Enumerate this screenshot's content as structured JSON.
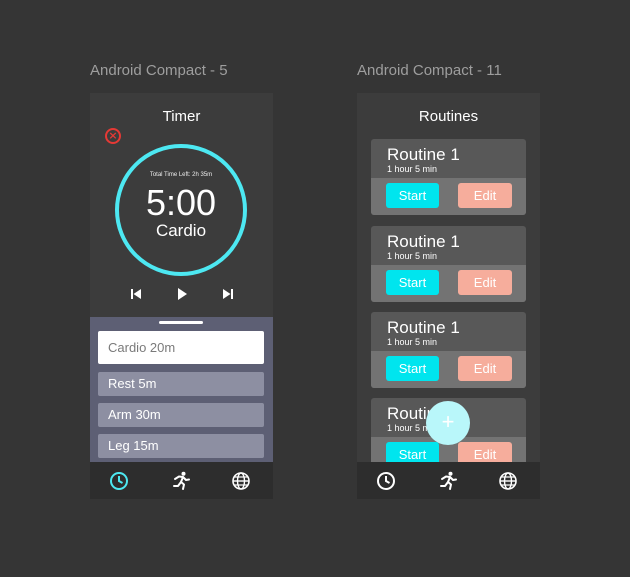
{
  "frames": {
    "left_label": "Android Compact - 5",
    "right_label": "Android Compact - 11"
  },
  "timer_screen": {
    "title": "Timer",
    "total_time_left": "Total Time Left: 2h 35m",
    "current_time": "5:00",
    "current_activity": "Cardio",
    "list": [
      "Cardio 20m",
      "Rest 5m",
      "Arm 30m",
      "Leg 15m"
    ]
  },
  "routines_screen": {
    "title": "Routines",
    "cards": [
      {
        "name": "Routine 1",
        "duration": "1 hour 5 min",
        "start": "Start",
        "edit": "Edit"
      },
      {
        "name": "Routine 1",
        "duration": "1 hour 5 min",
        "start": "Start",
        "edit": "Edit"
      },
      {
        "name": "Routine 1",
        "duration": "1 hour 5 min",
        "start": "Start",
        "edit": "Edit"
      },
      {
        "name": "Routine 1",
        "duration": "1 hour 5 min",
        "start": "Start",
        "edit": "Edit"
      }
    ],
    "fab_label": "+"
  },
  "icons": {
    "close": "close-circle-icon",
    "prev": "skip-previous-icon",
    "play": "play-icon",
    "next": "skip-next-icon",
    "nav": [
      "clock-icon",
      "running-person-icon",
      "globe-icon"
    ]
  },
  "colors": {
    "accent_cyan": "#4de8f2",
    "start_button": "#00e5ee",
    "edit_button": "#f6ad9c",
    "close_red": "#e53935",
    "active_nav": "#4de8f2"
  }
}
